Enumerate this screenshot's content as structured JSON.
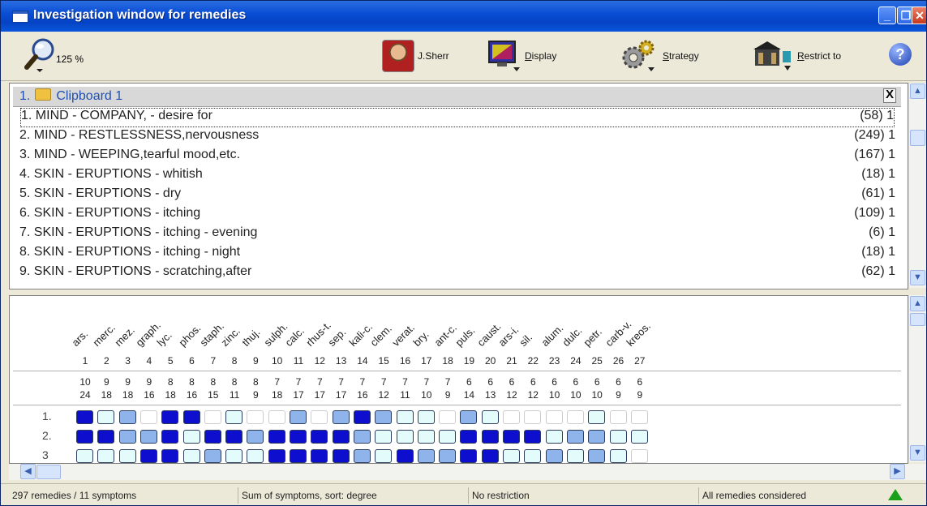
{
  "window": {
    "title": "Investigation window for remedies"
  },
  "toolbar": {
    "zoom": "125 %",
    "author": "J.Sherr",
    "display_label": "Display",
    "display_mnemonic": "D",
    "strategy_label": "Strategy",
    "strategy_mnemonic": "S",
    "restrict_label": "Restrict to",
    "restrict_mnemonic": "R",
    "help": "?"
  },
  "clipboard": {
    "label": "1.",
    "name": "Clipboard 1",
    "close": "X",
    "symptoms": [
      {
        "text": "1. MIND - COMPANY, - desire for",
        "count": "(58) 1"
      },
      {
        "text": "2. MIND - RESTLESSNESS,nervousness",
        "count": "(249) 1"
      },
      {
        "text": "3. MIND - WEEPING,tearful mood,etc.",
        "count": "(167) 1"
      },
      {
        "text": "4. SKIN - ERUPTIONS - whitish",
        "count": "(18) 1"
      },
      {
        "text": "5. SKIN - ERUPTIONS - dry",
        "count": "(61) 1"
      },
      {
        "text": "6. SKIN - ERUPTIONS - itching",
        "count": "(109) 1"
      },
      {
        "text": "7. SKIN - ERUPTIONS - itching - evening",
        "count": "(6) 1"
      },
      {
        "text": "8. SKIN - ERUPTIONS - itching - night",
        "count": "(18) 1"
      },
      {
        "text": "9. SKIN - ERUPTIONS - scratching,after",
        "count": "(62) 1"
      }
    ]
  },
  "remedies": {
    "names": [
      "ars.",
      "merc.",
      "mez.",
      "graph.",
      "lyc.",
      "phos.",
      "staph.",
      "zinc.",
      "thuj.",
      "sulph.",
      "calc.",
      "rhus-t.",
      "sep.",
      "kali-c.",
      "clem.",
      "verat.",
      "bry.",
      "ant-c.",
      "puls.",
      "caust.",
      "ars-i.",
      "sil.",
      "alum.",
      "dulc.",
      "petr.",
      "carb-v.",
      "kreos."
    ],
    "indexes": [
      "1",
      "2",
      "3",
      "4",
      "5",
      "6",
      "7",
      "8",
      "9",
      "10",
      "11",
      "12",
      "13",
      "14",
      "15",
      "16",
      "17",
      "18",
      "19",
      "20",
      "21",
      "22",
      "23",
      "24",
      "25",
      "26",
      "27"
    ],
    "symptom_counts": [
      "10",
      "9",
      "9",
      "9",
      "8",
      "8",
      "8",
      "8",
      "8",
      "7",
      "7",
      "7",
      "7",
      "7",
      "7",
      "7",
      "7",
      "7",
      "6",
      "6",
      "6",
      "6",
      "6",
      "6",
      "6",
      "6",
      "6"
    ],
    "degree_sums": [
      "24",
      "18",
      "18",
      "16",
      "18",
      "16",
      "15",
      "11",
      "9",
      "18",
      "17",
      "17",
      "17",
      "16",
      "12",
      "11",
      "10",
      "9",
      "14",
      "13",
      "12",
      "12",
      "10",
      "10",
      "10",
      "9",
      "9"
    ],
    "row_labels": [
      "1.",
      "2.",
      "3"
    ],
    "grades": [
      [
        3,
        1,
        2,
        0,
        3,
        3,
        0,
        1,
        0,
        0,
        2,
        0,
        2,
        3,
        2,
        1,
        1,
        0,
        2,
        1,
        0,
        0,
        0,
        0,
        1,
        0,
        0
      ],
      [
        3,
        3,
        2,
        2,
        3,
        1,
        3,
        3,
        2,
        3,
        3,
        3,
        3,
        2,
        1,
        1,
        1,
        1,
        3,
        3,
        3,
        3,
        1,
        2,
        2,
        1,
        1
      ],
      [
        1,
        1,
        1,
        3,
        3,
        1,
        2,
        1,
        1,
        3,
        3,
        3,
        3,
        2,
        1,
        3,
        2,
        2,
        3,
        3,
        1,
        1,
        2,
        1,
        2,
        1,
        0
      ]
    ]
  },
  "status": {
    "count": "297 remedies / 11 symptoms",
    "sort": "Sum of symptoms, sort: degree",
    "restriction": "No restriction",
    "scope": "All remedies considered"
  },
  "colors": {
    "grade3": "#0e0fce",
    "grade2": "#8fb4ec",
    "grade1": "#e4fbfb",
    "titlebar": "#0a4ed6",
    "clipboard_text": "#2050b0"
  }
}
